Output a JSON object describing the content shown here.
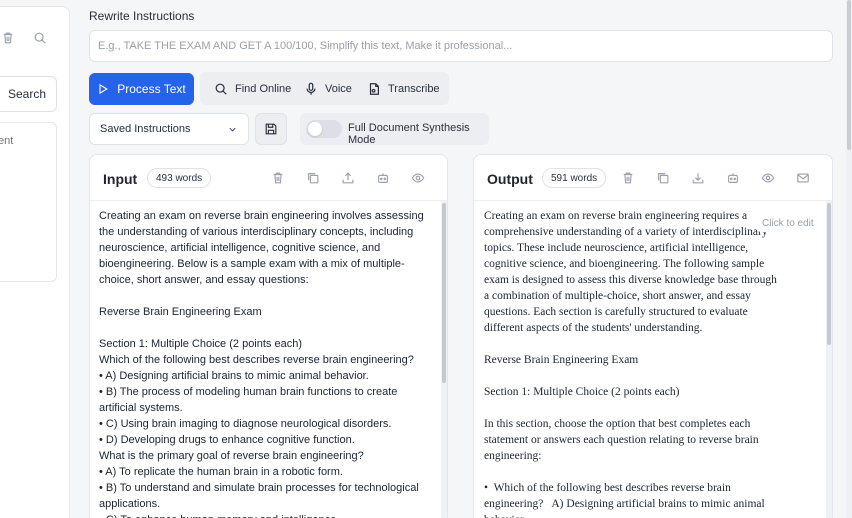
{
  "sidebar": {
    "search_label": "Search",
    "list_text": "ent"
  },
  "rewrite": {
    "label": "Rewrite Instructions",
    "placeholder": "E.g., TAKE THE EXAM AND GET A 100/100, Simplify this text, Make it professional..."
  },
  "toolbar": {
    "process_label": "Process Text",
    "find_online_label": "Find Online",
    "voice_label": "Voice",
    "transcribe_label": "Transcribe"
  },
  "options": {
    "saved_instructions": "Saved Instructions",
    "synthesis_label": "Full Document Synthesis Mode",
    "synthesis_on": false
  },
  "input_panel": {
    "title": "Input",
    "word_count": "493 words",
    "text": "Creating an exam on reverse brain engineering involves assessing the understanding of various interdisciplinary concepts, including neuroscience, artificial intelligence, cognitive science, and bioengineering. Below is a sample exam with a mix of multiple-choice, short answer, and essay questions:\n\nReverse Brain Engineering Exam\n\nSection 1: Multiple Choice (2 points each)\nWhich of the following best describes reverse brain engineering?\n• A) Designing artificial brains to mimic animal behavior.\n• B) The process of modeling human brain functions to create artificial systems.\n• C) Using brain imaging to diagnose neurological disorders.\n• D) Developing drugs to enhance cognitive function.\nWhat is the primary goal of reverse brain engineering?\n• A) To replicate the human brain in a robotic form.\n• B) To understand and simulate brain processes for technological applications.\n• C) To enhance human memory and intelligence."
  },
  "output_panel": {
    "title": "Output",
    "word_count": "591 words",
    "click_to_edit": "Click to edit",
    "text": "Creating an exam on reverse brain engineering requires a comprehensive understanding of a variety of interdisciplinary topics. These include neuroscience, artificial intelligence, cognitive science, and bioengineering. The following sample exam is designed to assess this diverse knowledge base through a combination of multiple-choice, short answer, and essay questions. Each section is carefully structured to evaluate different aspects of the students' understanding.\n\nReverse Brain Engineering Exam\n\nSection 1: Multiple Choice (2 points each)\n\nIn this section, choose the option that best completes each statement or answers each question relating to reverse brain engineering:\n\n•  Which of the following best describes reverse brain engineering?   A) Designing artificial brains to mimic animal behavior."
  },
  "colors": {
    "accent": "#2563eb",
    "background": "#f5f6f8"
  }
}
